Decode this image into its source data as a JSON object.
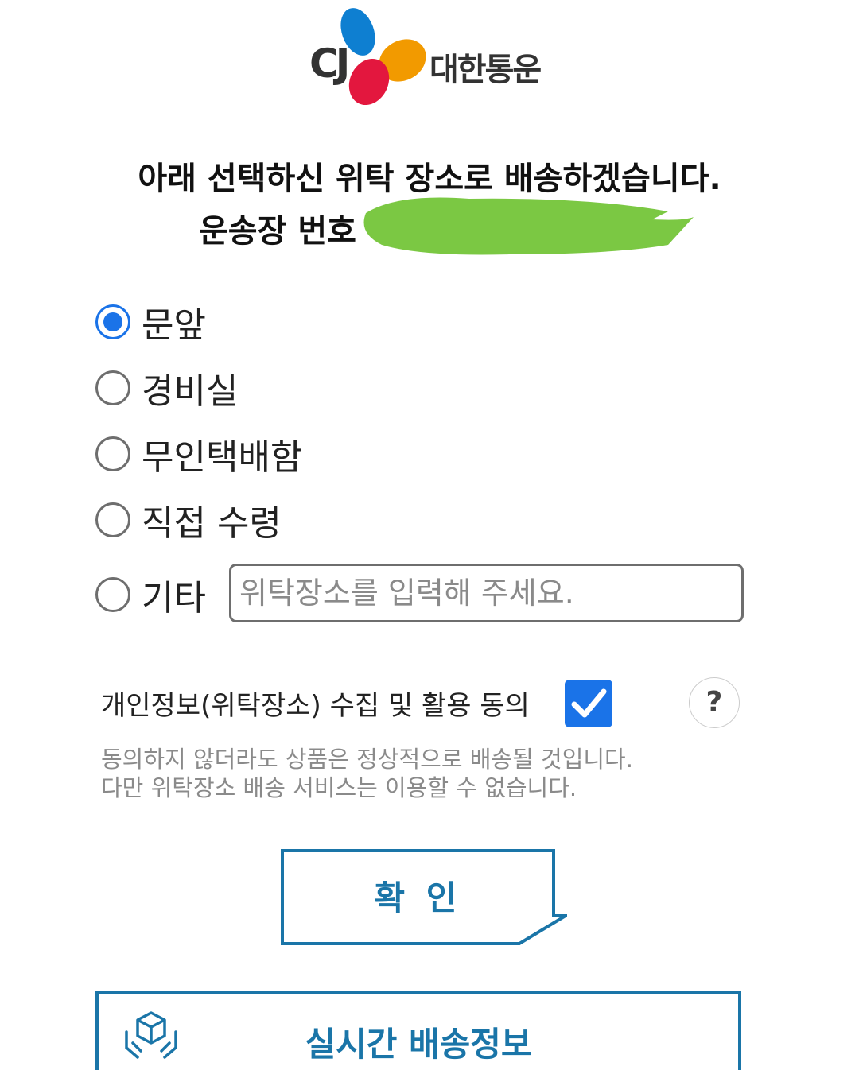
{
  "logo": {
    "mark": "CJ",
    "brand": "대한통운"
  },
  "headline": "아래 선택하신 위탁 장소로 배송하겠습니다.",
  "waybill_label": "운송장 번호",
  "options": [
    {
      "label": "문앞",
      "selected": true
    },
    {
      "label": "경비실",
      "selected": false
    },
    {
      "label": "무인택배함",
      "selected": false
    },
    {
      "label": "직접 수령",
      "selected": false
    },
    {
      "label": "기타",
      "selected": false
    }
  ],
  "other_input": {
    "placeholder": "위탁장소를 입력해 주세요.",
    "value": ""
  },
  "consent": {
    "label": "개인정보(위탁장소) 수집 및 활용 동의",
    "checked": true,
    "help": "?"
  },
  "notes": [
    "동의하지 않더라도 상품은 정상적으로 배송될 것입니다.",
    "다만 위탁장소 배송 서비스는 이용할 수 없습니다."
  ],
  "confirm_label": "확 인",
  "tracking_label": "실시간 배송정보",
  "colors": {
    "accent": "#1a73e8",
    "brand_blue": "#1a75a8",
    "redaction": "#7bc843"
  },
  "icons": [
    "checkbox-check-icon",
    "help-icon",
    "package-hands-icon"
  ]
}
